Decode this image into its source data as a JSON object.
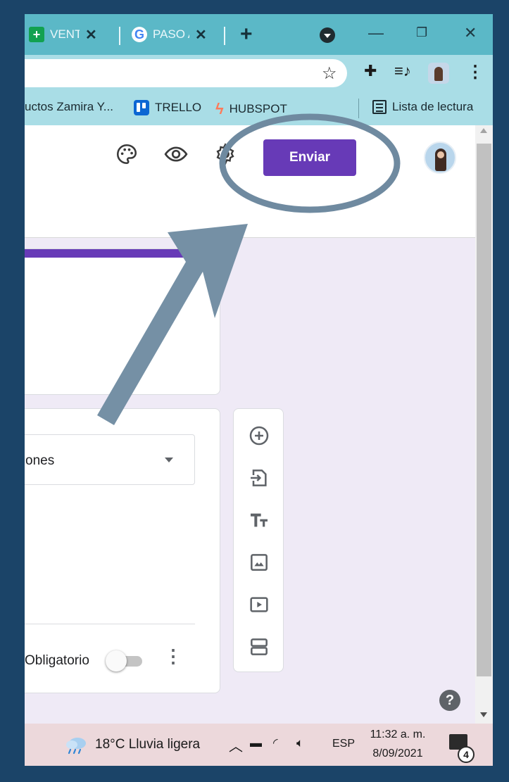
{
  "browser": {
    "tabs": [
      {
        "label": "VENTA",
        "icon": "sheets-icon"
      },
      {
        "label": "PASO A",
        "icon": "google-icon"
      }
    ],
    "tab_close_glyph": "✕",
    "new_tab_glyph": "+",
    "bookmarks": [
      {
        "label": "uctos Zamira Y...",
        "icon": "none"
      },
      {
        "label": "TRELLO",
        "icon": "trello-icon"
      },
      {
        "label": "HUBSPOT",
        "icon": "hubspot-icon"
      }
    ],
    "reading_list": "Lista de lectura"
  },
  "forms": {
    "send_label": "Enviar",
    "question_type": "ones",
    "required_label": "Obligatorio",
    "required_on": false
  },
  "taskbar": {
    "temperature": "18°C",
    "weather": "Lluvia ligera",
    "language": "ESP",
    "time": "11:32 a. m.",
    "date": "8/09/2021",
    "notifications": "4"
  },
  "colors": {
    "accent": "#673ab7",
    "annotation": "#6f8aa0",
    "tabstrip": "#5bb8c7",
    "toolbar": "#a9dde6"
  }
}
